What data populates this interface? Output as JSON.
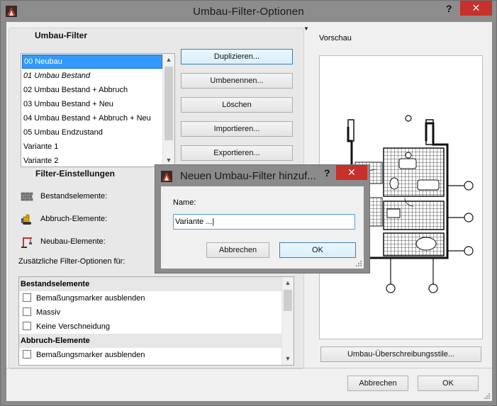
{
  "window": {
    "title": "Umbau-Filter-Optionen",
    "help_glyph": "?",
    "close_glyph": "✕"
  },
  "filters": {
    "header": "Umbau-Filter",
    "items": [
      {
        "label": "00 Neubau",
        "selected": true
      },
      {
        "label": "01 Umbau Bestand",
        "italic": true
      },
      {
        "label": "02 Umbau Bestand + Abbruch"
      },
      {
        "label": "03 Umbau Bestand + Neu"
      },
      {
        "label": "04 Umbau Bestand + Abbruch + Neu"
      },
      {
        "label": "05 Umbau Endzustand"
      },
      {
        "label": "Variante 1"
      },
      {
        "label": "Variante 2"
      }
    ],
    "buttons": {
      "duplicate": "Duplizieren...",
      "rename": "Umbenennen...",
      "delete": "Löschen",
      "import": "Importieren...",
      "export": "Exportieren..."
    }
  },
  "settings": {
    "header": "Filter-Einstellungen",
    "existing": "Bestandselemente:",
    "demolition": "Abbruch-Elemente:",
    "new": "Neubau-Elemente:"
  },
  "options": {
    "label": "Zusätzliche Filter-Optionen für:",
    "groups": [
      {
        "title": "Bestandselemente",
        "items": [
          "Bemaßungsmarker ausblenden",
          "Massiv",
          "Keine Verschneidung"
        ]
      },
      {
        "title": "Abbruch-Elemente",
        "items": [
          "Bemaßungsmarker ausblenden"
        ]
      }
    ]
  },
  "preview": {
    "label": "Vorschau",
    "override_button": "Umbau-Überschreibungsstile..."
  },
  "footer": {
    "cancel": "Abbrechen",
    "ok": "OK"
  },
  "dialog": {
    "title": "Neuen Umbau-Filter hinzuf...",
    "help_glyph": "?",
    "close_glyph": "✕",
    "name_label": "Name:",
    "name_value": "Variante ...|",
    "cancel": "Abbrechen",
    "ok": "OK"
  }
}
